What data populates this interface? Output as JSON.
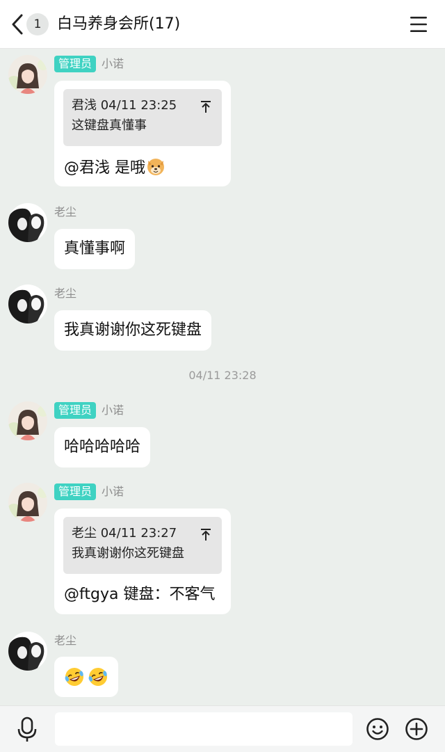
{
  "header": {
    "unread_count": "1",
    "title": "白马养身会所(17)"
  },
  "messages": [
    {
      "admin_tag": "管理员",
      "sender": "小诺",
      "quote_author_time": "君浅 04/11 23:25",
      "quote_text": "这键盘真懂事",
      "text": "@君浅 是哦",
      "emoji": "dog-face"
    },
    {
      "sender": "老尘",
      "text": "真懂事啊"
    },
    {
      "sender": "老尘",
      "text": "我真谢谢你这死键盘"
    },
    {
      "admin_tag": "管理员",
      "sender": "小诺",
      "text": "哈哈哈哈哈"
    },
    {
      "admin_tag": "管理员",
      "sender": "小诺",
      "quote_author_time": "老尘 04/11 23:27",
      "quote_text": "我真谢谢你这死键盘",
      "text": "@ftgya 键盘：不客气"
    },
    {
      "sender": "老尘",
      "emoji": [
        "rolling-laughing-face",
        "rolling-laughing-face"
      ]
    }
  ],
  "timestamp": "04/11 23:28",
  "input": {
    "placeholder": ""
  },
  "colors": {
    "admin_tag": "#3fd2c2",
    "background": "#ebefec",
    "bubble": "#ffffff",
    "quote": "#e6e6e6"
  }
}
